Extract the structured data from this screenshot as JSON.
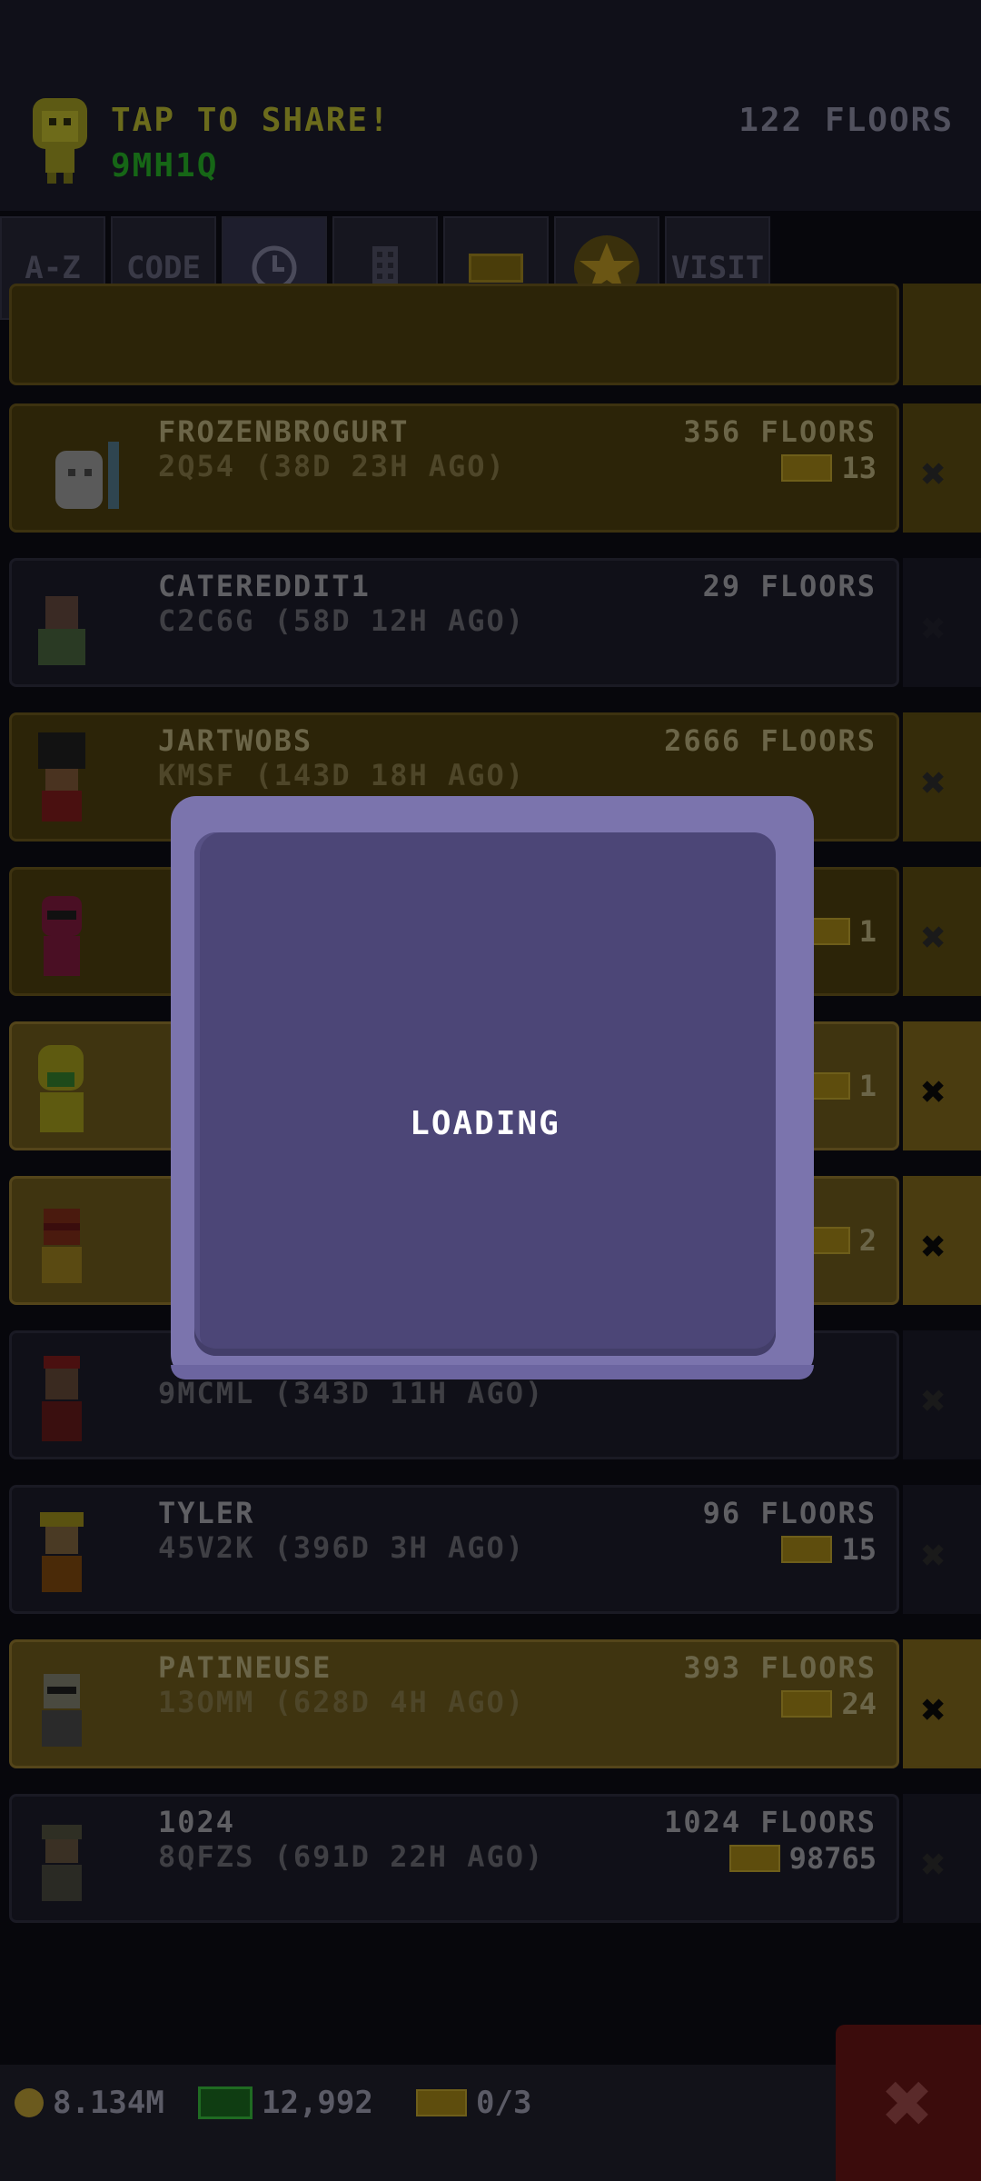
{
  "header": {
    "share_title": "TAP TO SHARE!",
    "share_code": "9MH1Q",
    "floors_total": "122 FLOORS"
  },
  "tabs": [
    {
      "label": "A-Z",
      "icon": "text"
    },
    {
      "label": "CODE",
      "icon": "text"
    },
    {
      "label": "",
      "icon": "clock-icon"
    },
    {
      "label": "",
      "icon": "building-icon"
    },
    {
      "label": "",
      "icon": "ticket-icon"
    },
    {
      "label": "",
      "icon": "star-icon"
    },
    {
      "label": "VISIT",
      "icon": "text"
    }
  ],
  "friends": [
    {
      "name": "FROZENBROGURT",
      "code": "2Q54 (38D 23H AGO)",
      "floors": "356 FLOORS",
      "tickets": "13",
      "style": "gold"
    },
    {
      "name": "CATEREDDIT1",
      "code": "C2C6G (58D 12H AGO)",
      "floors": "29 FLOORS",
      "tickets": "",
      "style": "dark"
    },
    {
      "name": "JARTWOBS",
      "code": "KMSF (143D 18H AGO)",
      "floors": "2666 FLOORS",
      "tickets": "",
      "style": "gold"
    },
    {
      "name": "",
      "code": "",
      "floors": "",
      "tickets": "1",
      "style": "gold"
    },
    {
      "name": "",
      "code": "",
      "floors": "",
      "tickets": "1",
      "style": "gold bright"
    },
    {
      "name": "",
      "code": "",
      "floors": "",
      "tickets": "2",
      "style": "gold bright"
    },
    {
      "name": "",
      "code": "9MCML (343D 11H AGO)",
      "floors": "",
      "tickets": "",
      "style": "dark"
    },
    {
      "name": "TYLER",
      "code": "45V2K (396D 3H AGO)",
      "floors": "96 FLOORS",
      "tickets": "15",
      "style": "dark"
    },
    {
      "name": "PATINEUSE",
      "code": "13OMM (628D 4H AGO)",
      "floors": "393 FLOORS",
      "tickets": "24",
      "style": "gold bright"
    },
    {
      "name": "1024",
      "code": "8QFZS (691D 22H AGO)",
      "floors": "1024 FLOORS",
      "tickets": "98765",
      "style": "dark"
    }
  ],
  "modal": {
    "text": "LOADING"
  },
  "footer": {
    "coins": "8.134M",
    "bux": "12,992",
    "tickets": "0/3"
  },
  "colors": {
    "modal_border": "#7b74ad",
    "modal_fill": "#4c4677",
    "gold_row": "#2c2408",
    "dark_row": "#101018"
  }
}
